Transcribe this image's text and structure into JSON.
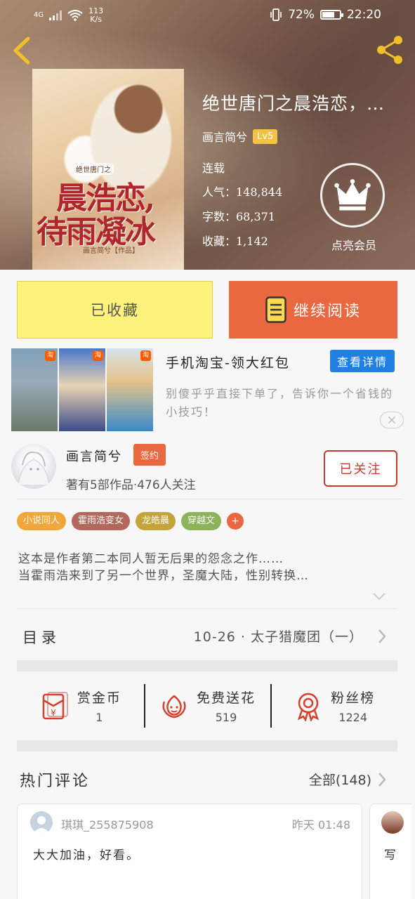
{
  "status_bar": {
    "network": "4G",
    "speed_value": "113",
    "speed_unit": "K/s",
    "battery": "72%",
    "battery_level": 0.72,
    "time": "22:20"
  },
  "book": {
    "title": "绝世唐门之晨浩恋，…",
    "author": "画言简兮",
    "level": "Lv5",
    "status": "连载",
    "popularity": "人气：148,844",
    "word_count": "字数：68,371",
    "collections": "收藏：1,142",
    "cover": {
      "series_label": "绝世唐门之",
      "title_line1": "晨浩恋,",
      "title_line2": "待雨凝冰",
      "author_credit": "画言简兮【作品】"
    }
  },
  "vip": {
    "label": "点亮会员"
  },
  "actions": {
    "collected": "已收藏",
    "continue_reading": "继续阅读"
  },
  "ad": {
    "title": "手机淘宝-领大红包",
    "button": "查看详情",
    "description": "别傻乎乎直接下单了，告诉你一个省钱的小技巧！",
    "badge": "淘"
  },
  "author_card": {
    "name": "画言简兮",
    "badge": "签约",
    "summary": "著有5部作品·476人关注",
    "follow_button": "已关注"
  },
  "tags": [
    {
      "label": "小说同人",
      "color": "#f0a73a"
    },
    {
      "label": "霍雨浩变女",
      "color": "#b0695a"
    },
    {
      "label": "龙皓晨",
      "color": "#c4a33b"
    },
    {
      "label": "穿越文",
      "color": "#8bb35a"
    }
  ],
  "tag_more": "+",
  "description": {
    "line1": "这本是作者第二本同人暂无后果的怨念之作……",
    "line2": "当霍雨浩来到了另一个世界，圣魔大陆，性别转换…"
  },
  "catalog": {
    "label": "目录",
    "latest": "10-26 · 太子猎魔团（一）"
  },
  "stats": [
    {
      "label": "赏金币",
      "value": "1",
      "icon": "red-envelope-icon"
    },
    {
      "label": "免费送花",
      "value": "519",
      "icon": "flower-icon"
    },
    {
      "label": "粉丝榜",
      "value": "1224",
      "icon": "medal-icon"
    }
  ],
  "comments": {
    "title": "热门评论",
    "all_label": "全部(148)",
    "items": [
      {
        "user": "琪琪_255875908",
        "time": "昨天 01:48",
        "text": "大大加油，好看。"
      },
      {
        "text": "写"
      }
    ]
  },
  "colors": {
    "accent": "#e9683f",
    "favorite_bg": "#fdf27b",
    "ad_button": "#1f7fe2",
    "follow": "#c63a2f"
  }
}
